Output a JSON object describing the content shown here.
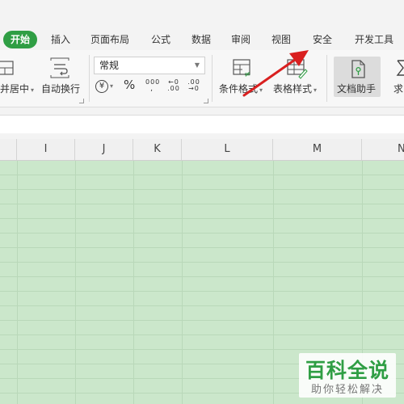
{
  "tabs": [
    {
      "label": "开始",
      "active": true
    },
    {
      "label": "插入"
    },
    {
      "label": "页面布局"
    },
    {
      "label": "公式"
    },
    {
      "label": "数据"
    },
    {
      "label": "审阅"
    },
    {
      "label": "视图"
    },
    {
      "label": "安全"
    },
    {
      "label": "开发工具"
    }
  ],
  "ribbon": {
    "merge_center": "并居中",
    "wrap_text": "自动换行",
    "number_format": "常规",
    "currency_symbol": "¥",
    "percent_symbol": "%",
    "thousands_symbol": "000",
    "increase_decimal": "←0 .00",
    "decrease_decimal": ".00 →0",
    "conditional_format": "条件格式",
    "table_style": "表格样式",
    "doc_helper": "文档助手",
    "sum_label": "求"
  },
  "grid": {
    "columns": [
      "",
      "I",
      "J",
      "K",
      "L",
      "M",
      "N"
    ]
  },
  "watermark": {
    "title": "百科全说",
    "subtitle": "助你轻松解决"
  },
  "colors": {
    "accent": "#2f9e44",
    "cell_fill": "#cbe7cb",
    "arrow": "#d92020"
  }
}
